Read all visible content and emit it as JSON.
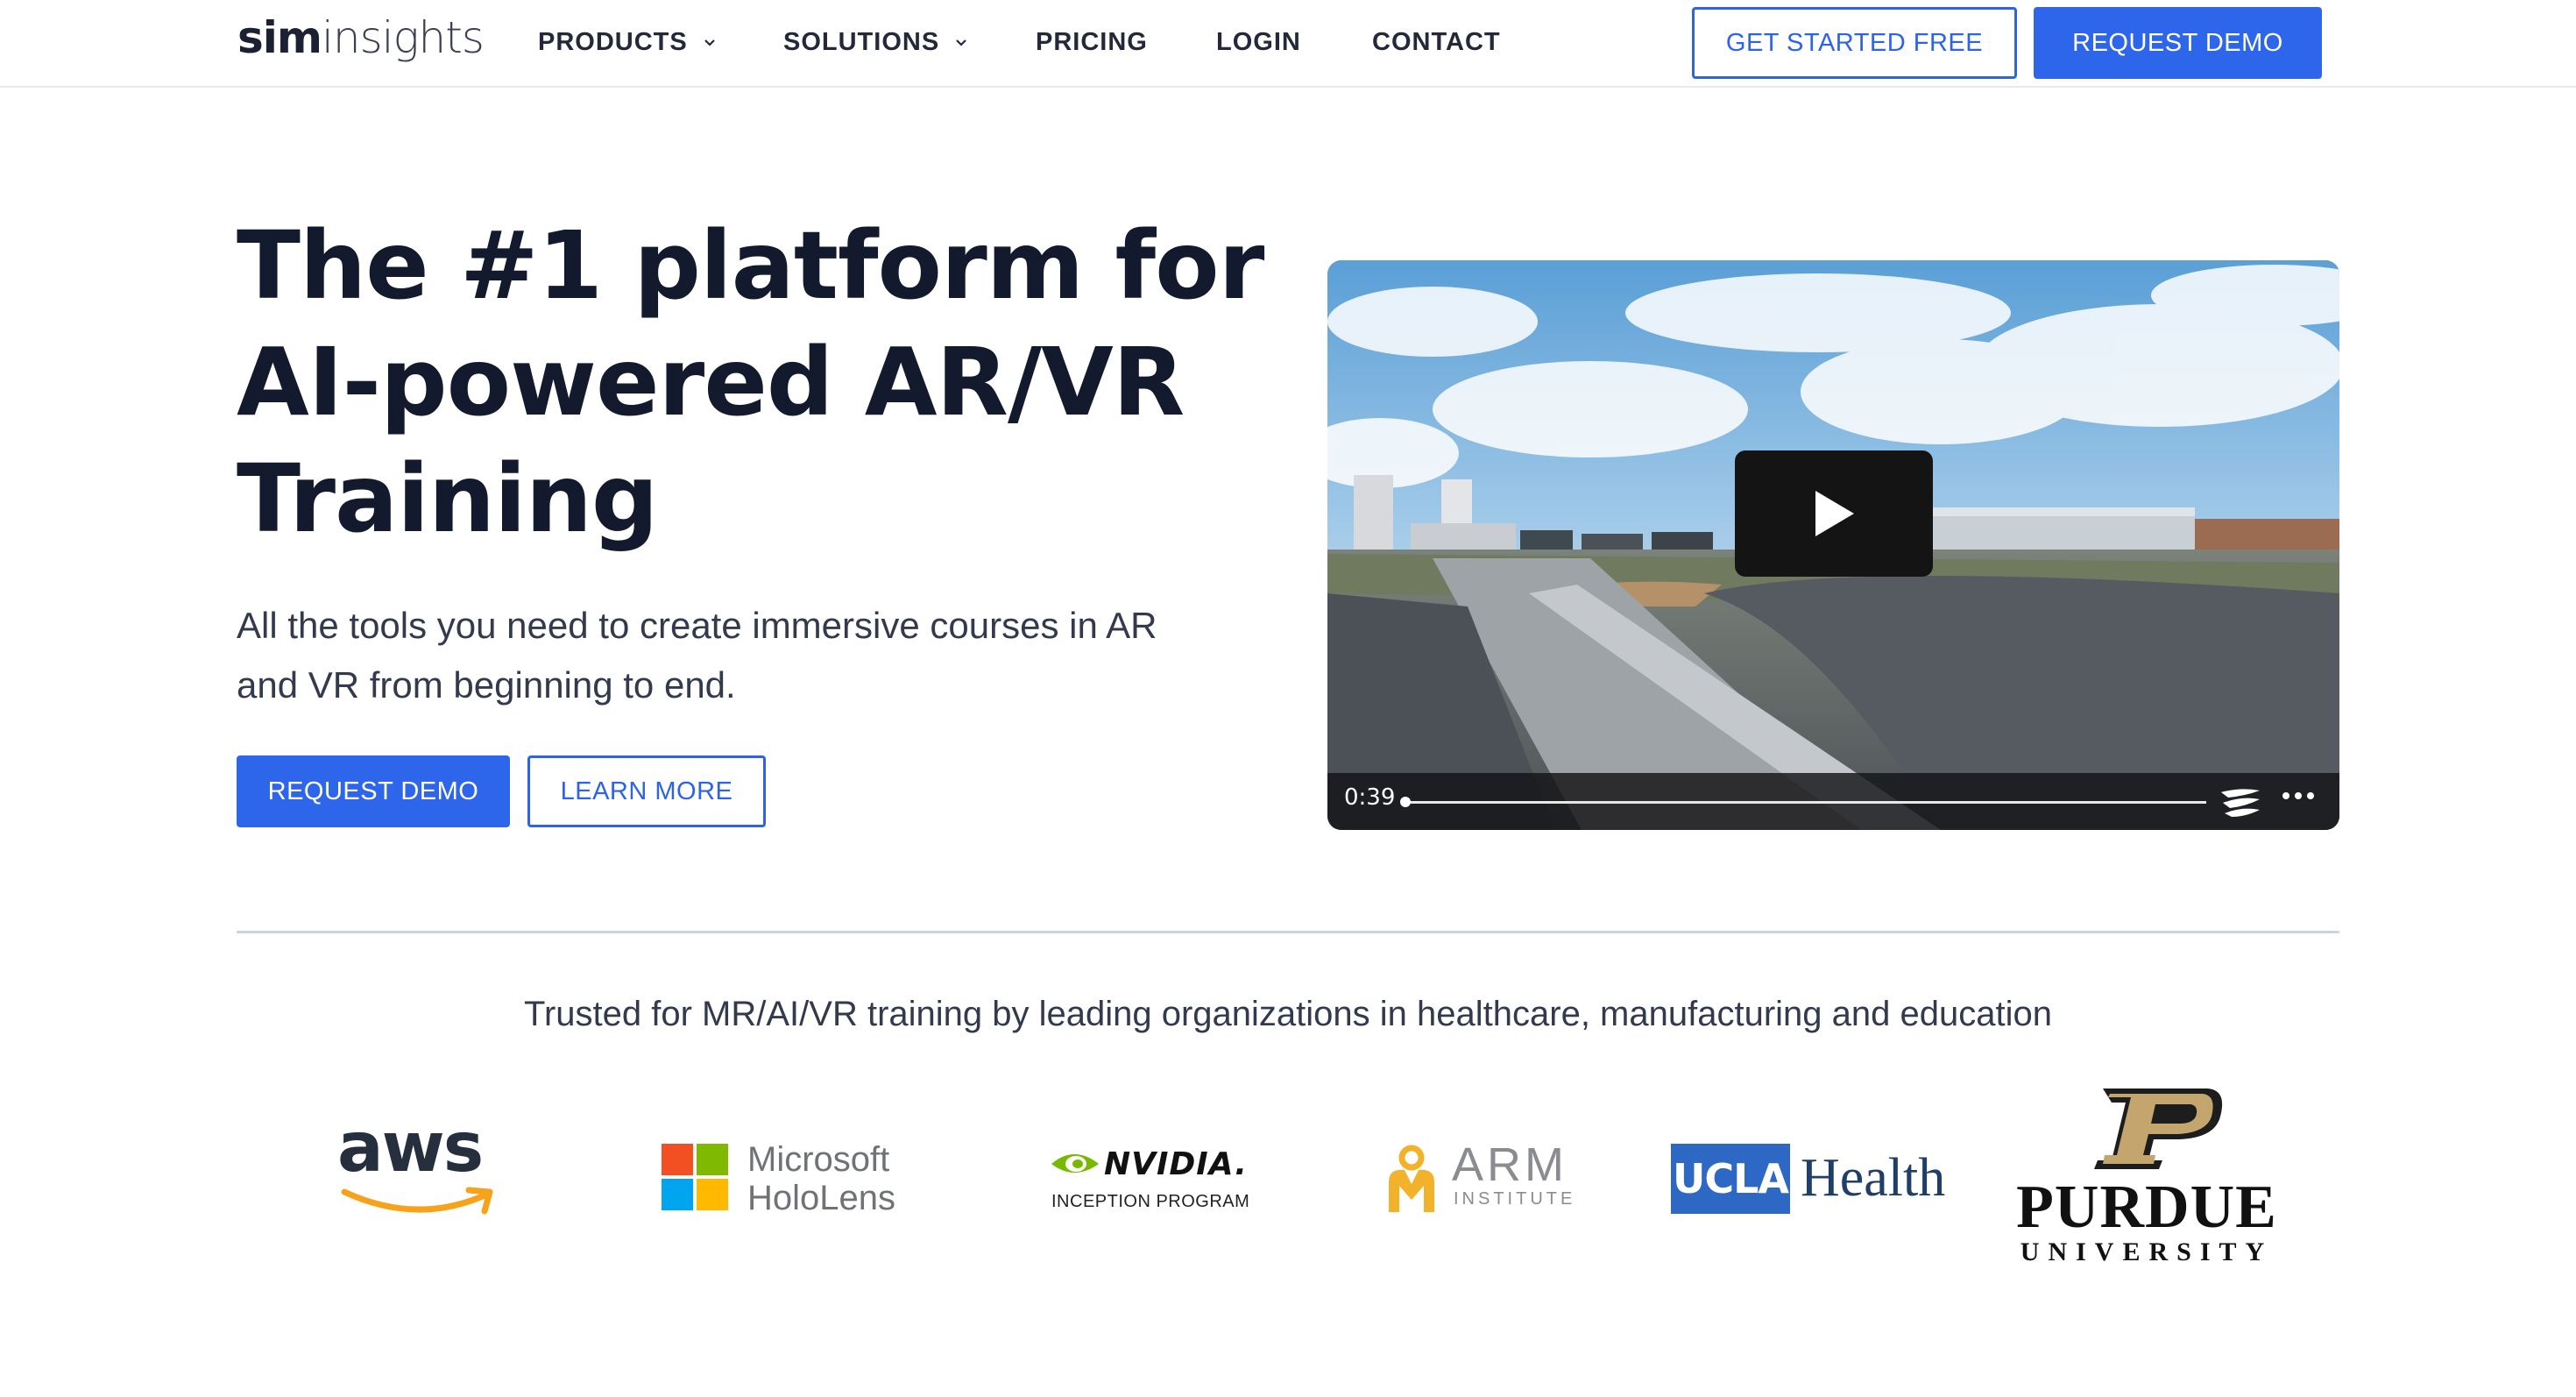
{
  "nav": {
    "logo_bold": "sim",
    "logo_light": "insights",
    "links": [
      "PRODUCTS",
      "SOLUTIONS",
      "PRICING",
      "LOGIN",
      "CONTACT"
    ],
    "get_started": "GET STARTED FREE",
    "request_demo": "REQUEST DEMO"
  },
  "hero": {
    "title_lines": [
      "The #1 platform for",
      "AI-powered AR/VR",
      "Training"
    ],
    "subtitle_lines": [
      "All the tools you need to create immersive courses in AR",
      "and VR from beginning to end."
    ],
    "primary_button": "REQUEST DEMO",
    "secondary_button": "LEARN MORE"
  },
  "video": {
    "time": "0:39",
    "progress_fraction": 0.005
  },
  "trusted": {
    "heading": "Trusted for MR/AI/VR training by leading organizations in healthcare, manufacturing and education"
  },
  "logos": {
    "aws": "aws",
    "microsoft_1": "Microsoft",
    "microsoft_2": "HoloLens",
    "nvidia": "NVIDIA.",
    "nvidia_sub": "INCEPTION PROGRAM",
    "arm": "ARM",
    "arm_sub": "INSTITUTE",
    "ucla": "UCLA",
    "health": "Health",
    "purdue": "PURDUE",
    "purdue_sub": "UNIVERSITY"
  },
  "colors": {
    "accent": "#2d66ea",
    "text_dark": "#141a2e",
    "divider": "#c9d6e2"
  },
  "icons": {
    "dropdown": "chevron-down-icon",
    "play": "play-icon",
    "more": "more-options-icon",
    "player_brand": "player-brand-icon"
  }
}
